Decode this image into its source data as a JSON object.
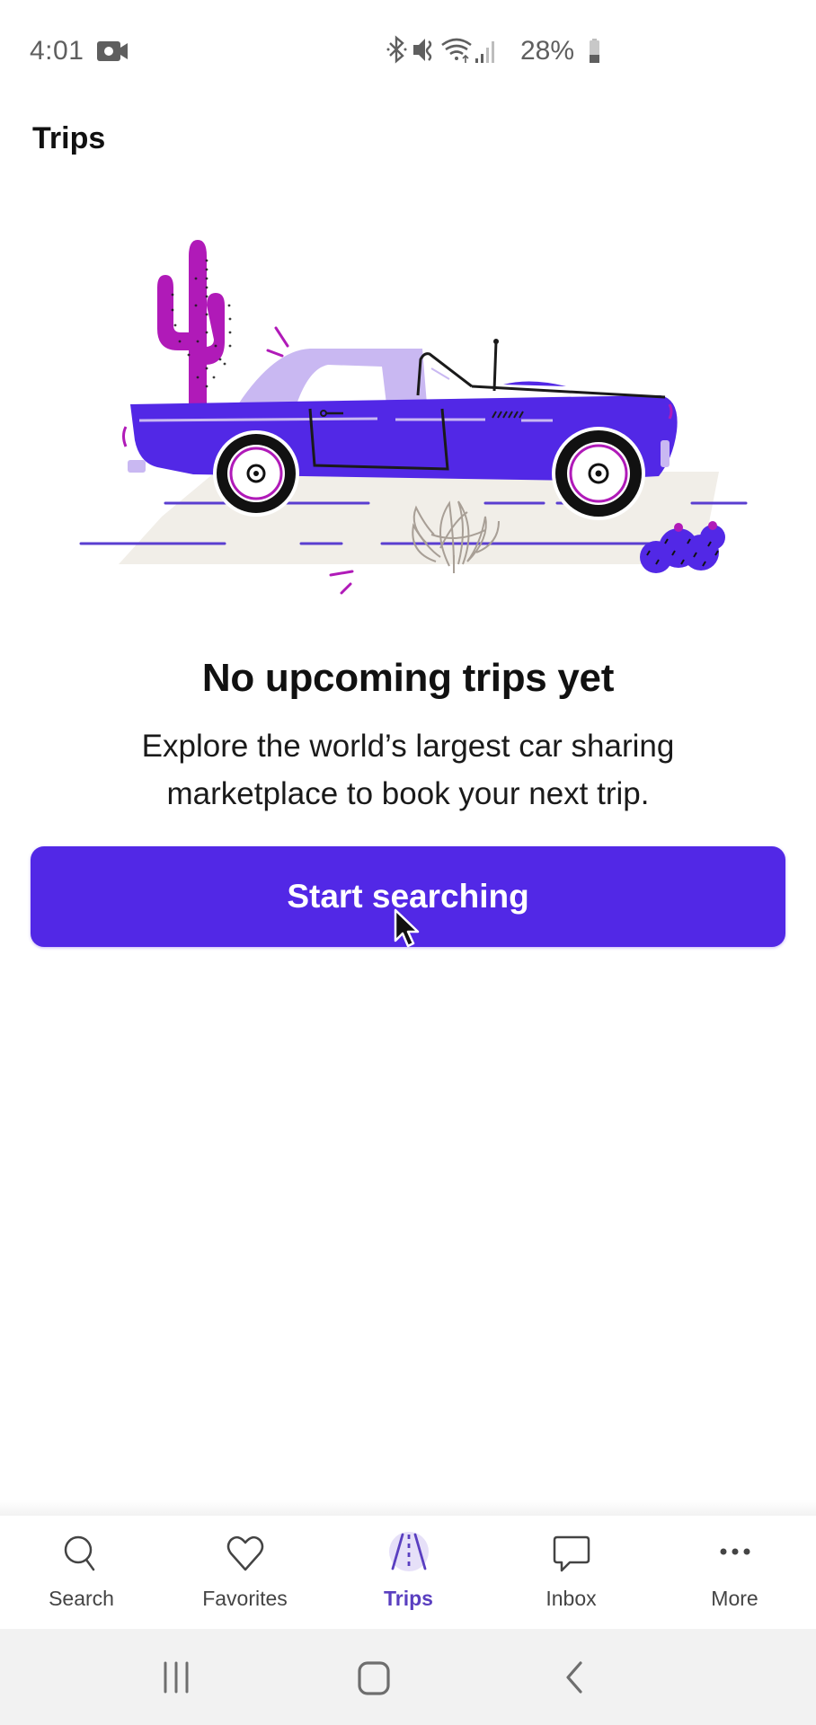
{
  "status_bar": {
    "time": "4:01",
    "battery_percent": "28%",
    "icons": [
      "video-record-icon",
      "bluetooth-icon",
      "mute-icon",
      "wifi-icon",
      "signal-icon",
      "battery-icon"
    ]
  },
  "header": {
    "title": "Trips"
  },
  "empty_state": {
    "illustration": "convertible-car-desert-illustration",
    "heading": "No upcoming trips yet",
    "body": "Explore the world’s largest car sharing marketplace to book your next trip.",
    "cta_label": "Start searching"
  },
  "colors": {
    "accent": "#5228e6",
    "active_tab": "#5a3fc0",
    "active_tab_bg": "#e6e0f8",
    "cactus": "#b01ab8",
    "car_roof": "#c9b8f2",
    "road": "#f1eee8"
  },
  "bottom_nav": {
    "items": [
      {
        "label": "Search",
        "icon": "search-icon",
        "active": false
      },
      {
        "label": "Favorites",
        "icon": "heart-icon",
        "active": false
      },
      {
        "label": "Trips",
        "icon": "road-icon",
        "active": true
      },
      {
        "label": "Inbox",
        "icon": "chat-bubble-icon",
        "active": false
      },
      {
        "label": "More",
        "icon": "more-dots-icon",
        "active": false
      }
    ]
  },
  "system_nav": {
    "buttons": [
      "recents",
      "home",
      "back"
    ]
  }
}
